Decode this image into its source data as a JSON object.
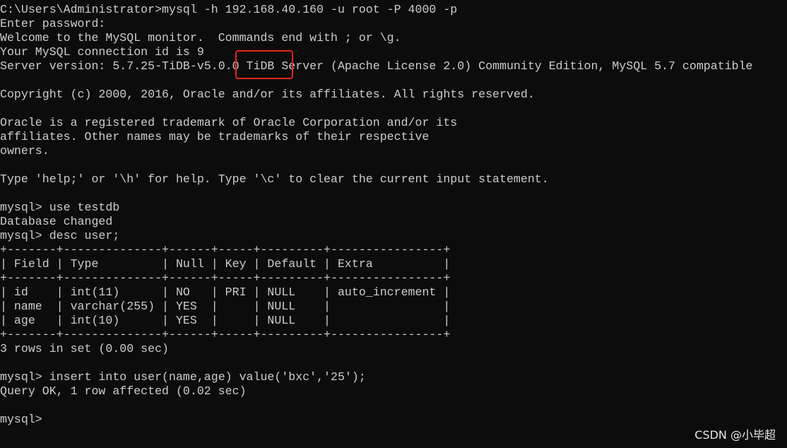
{
  "terminal": {
    "lines": [
      "C:\\Users\\Administrator>mysql -h 192.168.40.160 -u root -P 4000 -p",
      "Enter password:",
      "Welcome to the MySQL monitor.  Commands end with ; or \\g.",
      "Your MySQL connection id is 9",
      "Server version: 5.7.25-TiDB-v5.0.0 TiDB Server (Apache License 2.0) Community Edition, MySQL 5.7 compatible",
      "",
      "Copyright (c) 2000, 2016, Oracle and/or its affiliates. All rights reserved.",
      "",
      "Oracle is a registered trademark of Oracle Corporation and/or its",
      "affiliates. Other names may be trademarks of their respective",
      "owners.",
      "",
      "Type 'help;' or '\\h' for help. Type '\\c' to clear the current input statement.",
      "",
      "mysql> use testdb",
      "Database changed",
      "mysql> desc user;",
      "+-------+--------------+------+-----+---------+----------------+",
      "| Field | Type         | Null | Key | Default | Extra          |",
      "+-------+--------------+------+-----+---------+----------------+",
      "| id    | int(11)      | NO   | PRI | NULL    | auto_increment |",
      "| name  | varchar(255) | YES  |     | NULL    |                |",
      "| age   | int(10)      | YES  |     | NULL    |                |",
      "+-------+--------------+------+-----+---------+----------------+",
      "3 rows in set (0.00 sec)",
      "",
      "mysql> insert into user(name,age) value('bxc','25');",
      "Query OK, 1 row affected (0.02 sec)",
      "",
      "mysql>"
    ]
  },
  "highlight_color": "#e8231b",
  "watermark": "CSDN @小毕超"
}
